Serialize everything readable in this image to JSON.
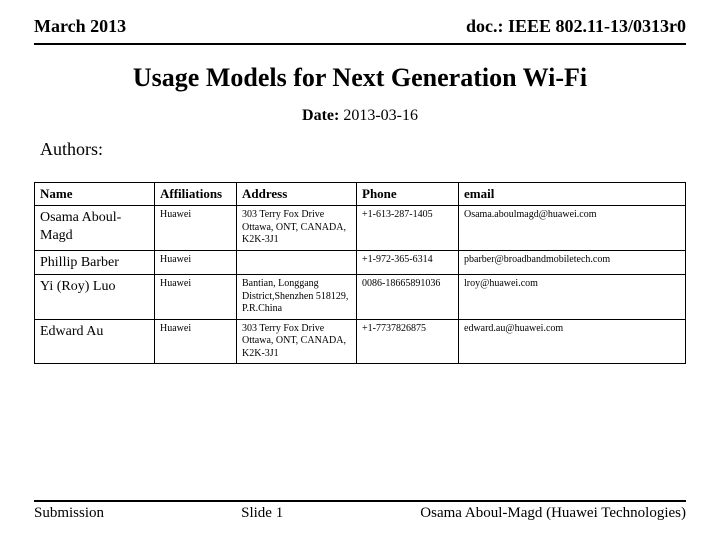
{
  "header": {
    "left": "March 2013",
    "right": "doc.: IEEE 802.11-13/0313r0"
  },
  "title": "Usage Models for Next Generation Wi-Fi",
  "date_label": "Date:",
  "date_value": "2013-03-16",
  "authors_label": "Authors:",
  "table": {
    "headers": [
      "Name",
      "Affiliations",
      "Address",
      "Phone",
      "email"
    ],
    "rows": [
      {
        "name": "Osama Aboul-Magd",
        "affiliation": "Huawei",
        "address": "303 Terry Fox Drive Ottawa, ONT, CANADA, K2K-3J1",
        "phone": "+1-613-287-1405",
        "email": "Osama.aboulmagd@huawei.com"
      },
      {
        "name": "Phillip Barber",
        "affiliation": "Huawei",
        "address": "",
        "phone": "+1-972-365-6314",
        "email": "pbarber@broadbandmobiletech.com"
      },
      {
        "name": "Yi (Roy) Luo",
        "affiliation": "Huawei",
        "address": "Bantian, Longgang District,Shenzhen 518129, P.R.China",
        "phone": "0086-18665891036",
        "email": "lroy@huawei.com"
      },
      {
        "name": "Edward Au",
        "affiliation": "Huawei",
        "address": "303 Terry Fox Drive Ottawa, ONT, CANADA, K2K-3J1",
        "phone": "+1-7737826875",
        "email": "edward.au@huawei.com"
      }
    ]
  },
  "footer": {
    "left": "Submission",
    "center": "Slide 1",
    "right": "Osama Aboul-Magd (Huawei Technologies)"
  }
}
